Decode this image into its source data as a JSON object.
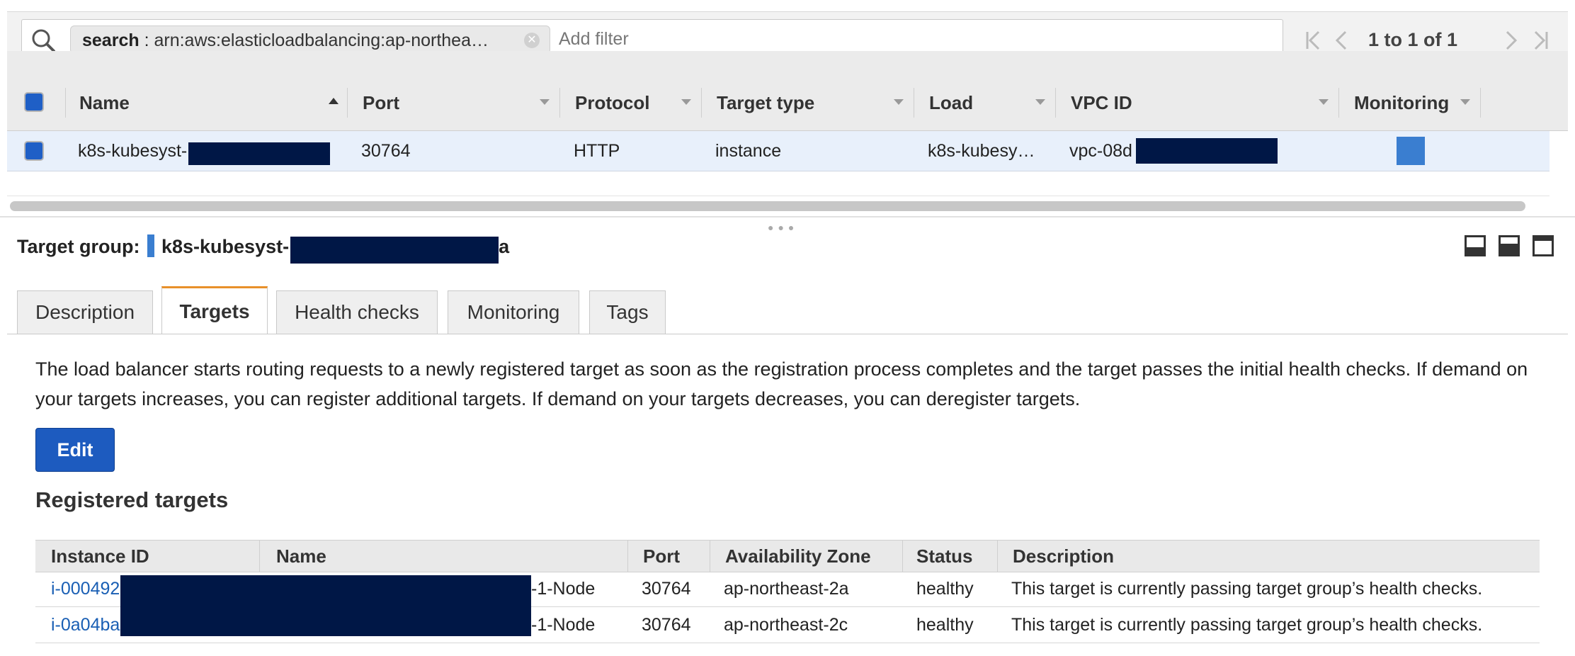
{
  "search": {
    "token_key": "search",
    "token_sep": " : ",
    "token_value": "arn:aws:elasticloadbalancing:ap-northea…",
    "add_filter_placeholder": "Add filter"
  },
  "pager": {
    "text": "1 to 1 of 1"
  },
  "grid": {
    "columns": [
      "Name",
      "Port",
      "Protocol",
      "Target type",
      "Load Balanc",
      "VPC ID",
      "Monitoring"
    ],
    "row": {
      "name": "k8s-kubesyst-",
      "port": "30764",
      "protocol": "HTTP",
      "target_type": "instance",
      "load_balancer": "k8s-kubesy…",
      "vpc_id": "vpc-08d"
    }
  },
  "details": {
    "label": "Target group:",
    "name_prefix": "k8s-kubesyst-",
    "name_suffix": "a",
    "tabs": [
      "Description",
      "Targets",
      "Health checks",
      "Monitoring",
      "Tags"
    ],
    "active_tab": "Targets",
    "intro": "The load balancer starts routing requests to a newly registered target as soon as the registration process completes and the target passes the initial health checks. If demand on your targets increases, you can register additional targets. If demand on your targets decreases, you can deregister targets.",
    "edit_label": "Edit",
    "registered_title": "Registered targets"
  },
  "targets": {
    "columns": [
      "Instance ID",
      "Name",
      "Port",
      "Availability Zone",
      "Status",
      "Description"
    ],
    "rows": [
      {
        "instance_id": "i-000492",
        "name_suffix": "-1-Node",
        "port": "30764",
        "az": "ap-northeast-2a",
        "status": "healthy",
        "description": "This target is currently passing target group’s health checks."
      },
      {
        "instance_id": "i-0a04ba",
        "name_suffix": "-1-Node",
        "port": "30764",
        "az": "ap-northeast-2c",
        "status": "healthy",
        "description": "This target is currently passing target group’s health checks."
      }
    ]
  },
  "colors": {
    "accent": "#1d5bbf",
    "selected_row": "#e8f0fb",
    "tab_active": "#e8902a",
    "redaction": "#001746"
  }
}
